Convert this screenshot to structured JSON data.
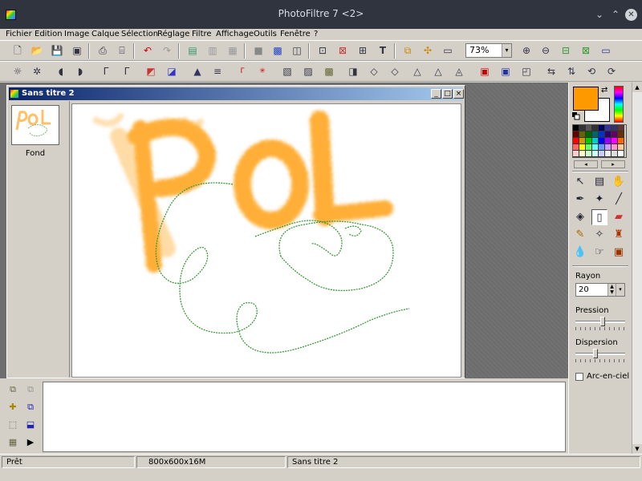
{
  "window": {
    "title": "PhotoFiltre 7 <2>",
    "controls": {
      "minimize": "⌄",
      "maximize": "⌃",
      "close": "✕"
    }
  },
  "menubar": [
    "Fichier",
    "Edition",
    "Image",
    "Calque",
    "Sélection",
    "Réglage",
    "Filtre",
    "Affichage",
    "Outils",
    "Fenêtre",
    "?"
  ],
  "toolbar": {
    "zoom_value": "73%",
    "zoom_arrow": "▾"
  },
  "document": {
    "title": "Sans titre 2",
    "controls": {
      "minimize": "_",
      "restore": "□",
      "close": "×"
    }
  },
  "layers": {
    "items": [
      {
        "label": "Fond"
      }
    ]
  },
  "tool_panel": {
    "foreground_color": "#ff9900",
    "background_color": "#ffffff",
    "swap_icon": "⇄",
    "palette_nav": {
      "left": "◂",
      "right": "▸"
    },
    "radius_label": "Rayon",
    "radius_value": "20",
    "radius_up": "▲",
    "radius_down": "▼",
    "radius_dropdown": "▾",
    "pressure_label": "Pression",
    "pressure_level": 0.55,
    "dispersion_label": "Dispersion",
    "dispersion_level": 0.4,
    "rainbow_label": "Arc-en-ciel",
    "rainbow_checked": false
  },
  "scrollbar": {
    "up": "▲",
    "down": "▼"
  },
  "bottom_panel": {
    "play_icon": "▶"
  },
  "statusbar": {
    "status": "Prêt",
    "image_info": "800x600x16M",
    "doc_name": "Sans titre 2"
  },
  "colors": {
    "titlebar": "#2f343f",
    "brush_orange": "#ff9900",
    "stroke_green": "#3a9a3a",
    "doc_title_gradient_start": "#0a246a"
  }
}
